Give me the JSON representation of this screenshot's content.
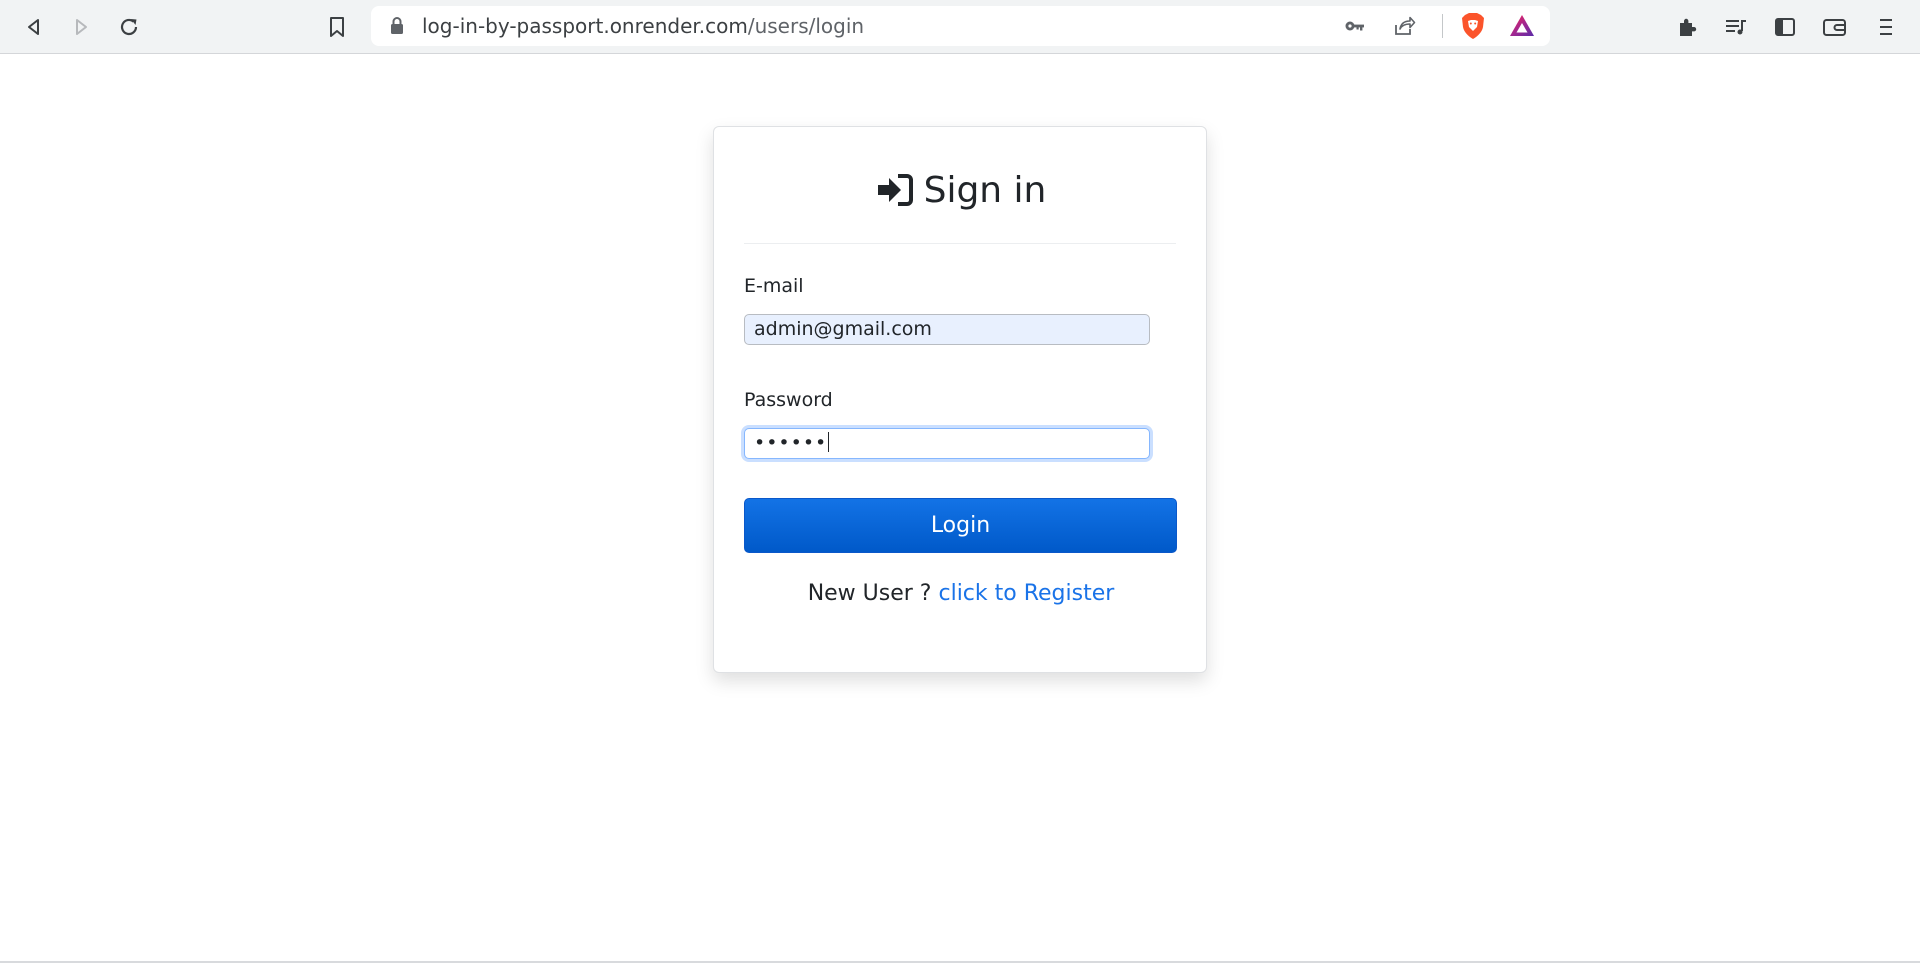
{
  "browser": {
    "url_host": "log-in-by-passport.onrender.com",
    "url_path": "/users/login",
    "icons": {
      "back": "back-arrow-icon",
      "forward": "forward-arrow-icon",
      "reload": "reload-icon",
      "bookmark": "bookmark-icon",
      "lock": "lock-icon",
      "key": "key-icon",
      "share": "share-icon",
      "brave_shields": "brave-lion-icon",
      "brave_rewards": "brave-rewards-triangle-icon",
      "extensions": "puzzle-piece-icon",
      "playlist": "playlist-icon",
      "sidebar": "sidebar-icon",
      "wallet": "wallet-icon",
      "menu": "hamburger-menu-icon"
    }
  },
  "login_card": {
    "title": "Sign in",
    "title_icon": "sign-in-arrow-icon",
    "email_label": "E-mail",
    "email_value": "admin@gmail.com",
    "password_label": "Password",
    "password_value": "••••••",
    "login_button": "Login",
    "new_user_text": "New User ?",
    "register_link": "click to Register"
  },
  "colors": {
    "button_blue": "#0d6efd",
    "link_blue": "#1a73e8",
    "autofill_bg": "#e8f0fe",
    "brave_orange": "#fb542b"
  }
}
